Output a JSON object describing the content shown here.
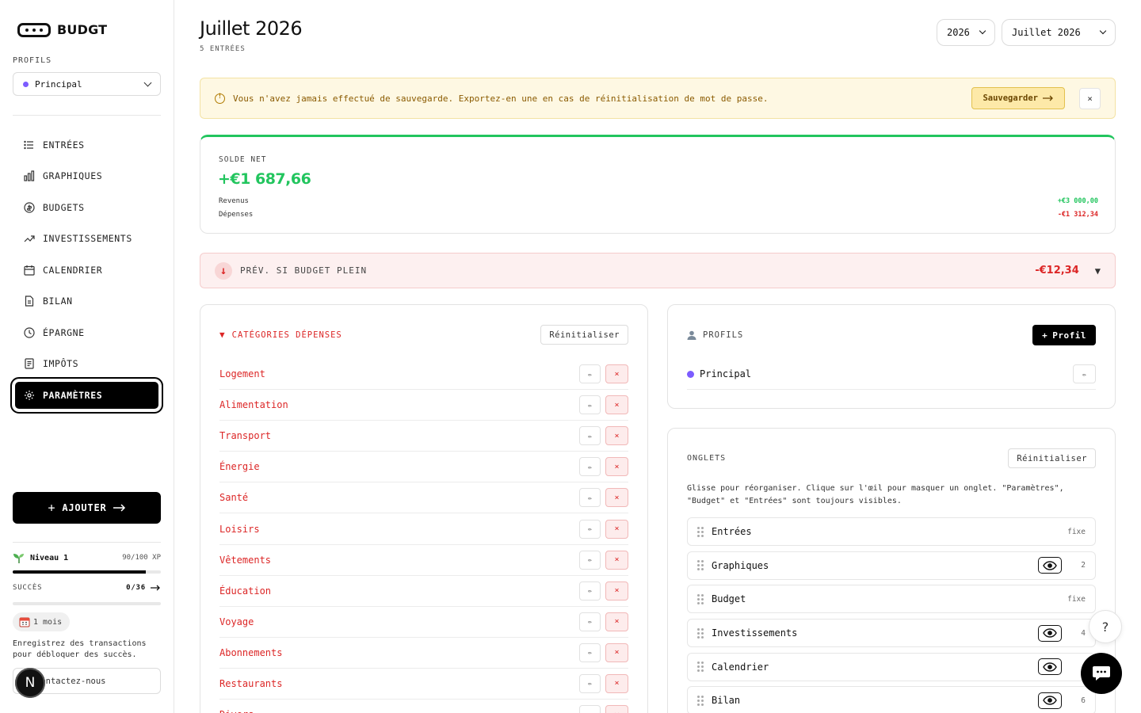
{
  "app": {
    "name": "BUDGT"
  },
  "sidebar": {
    "profiles_label": "PROFILS",
    "profile_selected": "Principal",
    "profile_color": "#7c5cff",
    "nav": [
      {
        "label": "ENTRÉES",
        "icon": "list-icon"
      },
      {
        "label": "GRAPHIQUES",
        "icon": "bar-chart-icon"
      },
      {
        "label": "BUDGETS",
        "icon": "coin-icon"
      },
      {
        "label": "INVESTISSEMENTS",
        "icon": "trending-up-icon"
      },
      {
        "label": "CALENDRIER",
        "icon": "calendar-icon"
      },
      {
        "label": "BILAN",
        "icon": "document-icon"
      },
      {
        "label": "ÉPARGNE",
        "icon": "clock-icon"
      },
      {
        "label": "IMPÔTS",
        "icon": "receipt-icon"
      },
      {
        "label": "PARAMÈTRES",
        "icon": "gear-icon",
        "active": true
      }
    ],
    "add_label": "AJOUTER",
    "level_label": "Niveau 1",
    "xp_text": "90/100 XP",
    "xp_progress": 0.9,
    "success_label": "SUCCÈS",
    "success_count": "0/36",
    "success_progress": 0,
    "month_badge": "1 mois",
    "help_text": "Enregistrez des transactions pour débloquer des succès.",
    "contact_label": "Contactez-nous",
    "avatar_letter": "N"
  },
  "header": {
    "title": "Juillet 2026",
    "subtitle": "5 ENTRÉES",
    "year_select": "2026",
    "month_select": "Juillet 2026"
  },
  "warning": {
    "text": "Vous n'avez jamais effectué de sauvegarde. Exportez-en une en cas de réinitialisation de mot de passe.",
    "save_label": "Sauvegarder",
    "close_label": "×"
  },
  "balance": {
    "label": "SOLDE NET",
    "value": "+€1 687,66",
    "income_label": "Revenus",
    "income_value": "+€3 000,00",
    "expense_label": "Dépenses",
    "expense_value": "-€1 312,34"
  },
  "forecast": {
    "label": "PRÉV. SI BUDGET PLEIN",
    "value": "-€12,34"
  },
  "categories": {
    "title": "CATÉGORIES DÉPENSES",
    "reset_label": "Réinitialiser",
    "edit_glyph": "✏",
    "delete_glyph": "×",
    "items": [
      "Logement",
      "Alimentation",
      "Transport",
      "Énergie",
      "Santé",
      "Loisirs",
      "Vêtements",
      "Éducation",
      "Voyage",
      "Abonnements",
      "Restaurants",
      "Divers"
    ]
  },
  "profiles_card": {
    "title": "PROFILS",
    "add_label": "Profil",
    "items": [
      {
        "name": "Principal",
        "color": "#7c5cff"
      }
    ],
    "edit_glyph": "✏"
  },
  "tabs_card": {
    "title": "ONGLETS",
    "reset_label": "Réinitialiser",
    "help": "Glisse pour réorganiser. Clique sur l'œil pour masquer un onglet. \"Paramètres\", \"Budget\" et \"Entrées\" sont toujours visibles.",
    "items": [
      {
        "name": "Entrées",
        "fixed": "fixe"
      },
      {
        "name": "Graphiques",
        "num": "2"
      },
      {
        "name": "Budget",
        "fixed": "fixe"
      },
      {
        "name": "Investissements",
        "num": "4"
      },
      {
        "name": "Calendrier",
        "num": ""
      },
      {
        "name": "Bilan",
        "num": "6"
      }
    ]
  },
  "colors": {
    "positive": "#22c55e",
    "negative": "#dc2626",
    "warning_bg": "#fef8e3"
  }
}
